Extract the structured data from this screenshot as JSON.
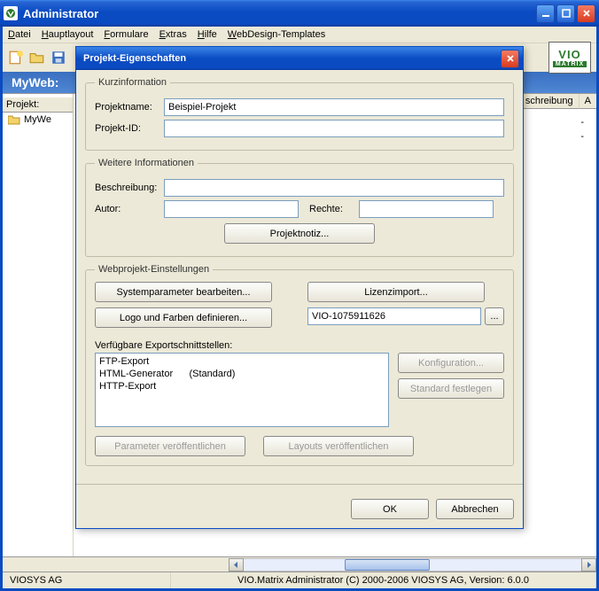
{
  "app": {
    "title": "Administrator"
  },
  "menu": {
    "items": [
      "Datei",
      "Hauptlayout",
      "Formulare",
      "Extras",
      "Hilfe",
      "WebDesign-Templates"
    ]
  },
  "logo": {
    "l1": "VIO",
    "l2": "MATRIX"
  },
  "blue_strip": "MyWeb:",
  "tree": {
    "header": "Projekt:",
    "item": "MyWe"
  },
  "right_cols": {
    "c1": "schreibung",
    "c2": "A"
  },
  "dialog": {
    "title": "Projekt-Eigenschaften",
    "g1": {
      "legend": "Kurzinformation",
      "name_lbl": "Projektname:",
      "name_val": "Beispiel-Projekt",
      "id_lbl": "Projekt-ID:",
      "id_val": ""
    },
    "g2": {
      "legend": "Weitere Informationen",
      "desc_lbl": "Beschreibung:",
      "desc_val": "",
      "author_lbl": "Autor:",
      "author_val": "",
      "rights_lbl": "Rechte:",
      "rights_val": "",
      "note_btn": "Projektnotiz..."
    },
    "g3": {
      "legend": "Webprojekt-Einstellungen",
      "sys_btn": "Systemparameter bearbeiten...",
      "logo_btn": "Logo und Farben definieren...",
      "lic_btn": "Lizenzimport...",
      "lic_val": "VIO-1075911626",
      "browse": "...",
      "list_lbl": "Verfügbare Exportschnittstellen:",
      "list": [
        {
          "name": "FTP-Export",
          "suffix": ""
        },
        {
          "name": "HTML-Generator",
          "suffix": "(Standard)"
        },
        {
          "name": "HTTP-Export",
          "suffix": ""
        }
      ],
      "cfg_btn": "Konfiguration...",
      "std_btn": "Standard festlegen",
      "pub_param": "Parameter veröffentlichen",
      "pub_layout": "Layouts veröffentlichen"
    },
    "ok": "OK",
    "cancel": "Abbrechen"
  },
  "status": {
    "left": "VIOSYS AG",
    "center": "VIO.Matrix Administrator (C) 2000-2006 VIOSYS AG, Version: 6.0.0"
  }
}
